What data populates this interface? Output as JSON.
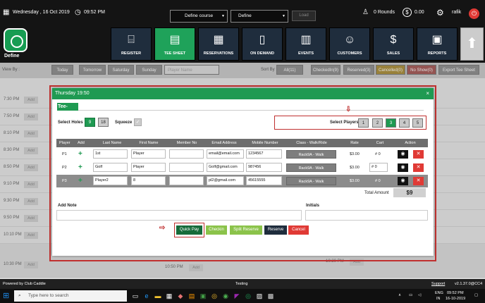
{
  "topbar": {
    "date": "Wednesday ,  16 Oct 2019",
    "time": "09:52 PM",
    "course_select": "Define course",
    "define_select": "Define",
    "load": "Load",
    "rounds": "0 Rounds",
    "amount": "0.00",
    "user": "rafik",
    "icons": {
      "calendar": "calendar-icon",
      "clock": "clock-icon",
      "golfer": "golfer-icon",
      "dollar": "dollar-icon",
      "gear": "gear-icon",
      "power": "power-icon"
    }
  },
  "logo": {
    "text": "Define"
  },
  "nav": [
    {
      "label": "REGISTER",
      "icon": "⌸"
    },
    {
      "label": "TEE SHEET",
      "icon": "▤",
      "active": true
    },
    {
      "label": "RESERVATIONS",
      "icon": "▦"
    },
    {
      "label": "ON DEMAND",
      "icon": "▯"
    },
    {
      "label": "EVENTS",
      "icon": "▥"
    },
    {
      "label": "CUSTOMERS",
      "icon": "☺"
    },
    {
      "label": "SALES",
      "icon": "$"
    },
    {
      "label": "REPORTS",
      "icon": "▣"
    }
  ],
  "filters": {
    "view_by": "View By :",
    "today": "Today",
    "tomorrow": "Tomorrow",
    "saturday": "Saturday",
    "sunday": "Sunday",
    "player_name": "Player Name",
    "sort_by": "Sort By :",
    "all": "All(11)",
    "checkedin": "CheckedIn(9)",
    "reserved": "Reserved(3)",
    "cancelled": "Cancelled(0)",
    "noshow": "No Show(0)",
    "export": "Export Tee Sheet"
  },
  "bg": {
    "times": [
      "7:30 PM",
      "7:50 PM",
      "8:10 PM",
      "8:30 PM",
      "8:50 PM",
      "9:10 PM",
      "9:30 PM",
      "9:50 PM",
      "10:10 PM",
      "10:30 PM"
    ],
    "add": "Add",
    "mid_time": "10:50 PM",
    "right_time": "10:20 PM"
  },
  "modal": {
    "title": "Thursday 19:50",
    "close": "×",
    "section": "Tee-Time",
    "select_holes": "Select Holes",
    "holes": [
      "9",
      "18"
    ],
    "squeeze": "Squeeze",
    "select_players": "Select Players",
    "players_opts": [
      "1",
      "2",
      "3",
      "4",
      "5"
    ],
    "headers": {
      "player": "Player",
      "add": "Add",
      "last": "Last Name",
      "first": "First Name",
      "member": "Member No",
      "email": "Email Address",
      "mobile": "Mobile Number",
      "class": "Class - Walk/Ride",
      "rate": "Rate",
      "cart": "Cart",
      "action": "Action"
    },
    "rows": [
      {
        "p": "P1",
        "last": "1st",
        "first": "Player",
        "member": "",
        "email": "email@email.com",
        "mobile": "1234567",
        "class": "Rack9A - Walk",
        "rate": "$3.00",
        "cart": "# 0"
      },
      {
        "p": "P2",
        "last": "Golf",
        "first": "Player",
        "member": "",
        "email": "Golf@gmail.com",
        "mobile": "987456",
        "class": "Rack9A - Walk",
        "rate": "$3.00",
        "cart": "# 0"
      },
      {
        "p": "P3",
        "last": "Player2",
        "first": "8",
        "member": "",
        "email": "pl2@gmail.com",
        "mobile": "45615555",
        "class": "Rack9A - Walk",
        "rate": "$3.00",
        "cart": "# 0"
      }
    ],
    "total_label": "Total Amount",
    "total": "$9",
    "add_note": "Add Note",
    "initials": "Initials",
    "buttons": {
      "quick_pay": "Quick Pay",
      "checkin": "Checkin",
      "split": "Split Reserve",
      "reserve": "Reserve",
      "cancel": "Cancel"
    }
  },
  "bottombar": {
    "powered": "Powered by Club Caddie",
    "testing": "Testing",
    "support": "Support",
    "version": "v2.1.37.0@CC4"
  },
  "taskbar": {
    "search": "Type here to search",
    "lang": "ENG",
    "region": "IN",
    "time": "09:52 PM",
    "date": "16-10-2019"
  },
  "colors": {
    "green": "#1f9a52",
    "red": "#c0302f",
    "navy": "#1f2d3d"
  }
}
